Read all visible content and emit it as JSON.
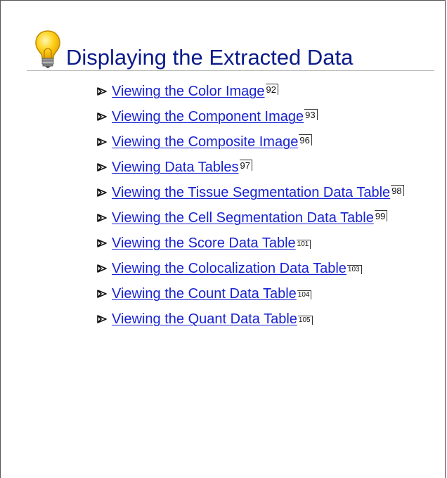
{
  "section": {
    "title": "Displaying the Extracted Data",
    "icon": "lightbulb-icon"
  },
  "toc": {
    "items": [
      {
        "label": "Viewing the Color Image",
        "page": "92"
      },
      {
        "label": "Viewing the Component Image",
        "page": "93"
      },
      {
        "label": "Viewing the Composite Image",
        "page": "96"
      },
      {
        "label": "Viewing Data Tables",
        "page": "97"
      },
      {
        "label": "Viewing the Tissue Segmentation Data Table",
        "page": "98"
      },
      {
        "label": "Viewing the Cell Segmentation Data Table",
        "page": "99"
      },
      {
        "label": "Viewing the Score Data Table",
        "page": "101"
      },
      {
        "label": "Viewing the Colocalization Data Table",
        "page": "103"
      },
      {
        "label": "Viewing the Count Data Table",
        "page": "104"
      },
      {
        "label": "Viewing the Quant Data Table",
        "page": "105"
      }
    ]
  },
  "colors": {
    "title": "#0b1b8a",
    "link": "#1822d0",
    "bulb": "#f5c400"
  }
}
